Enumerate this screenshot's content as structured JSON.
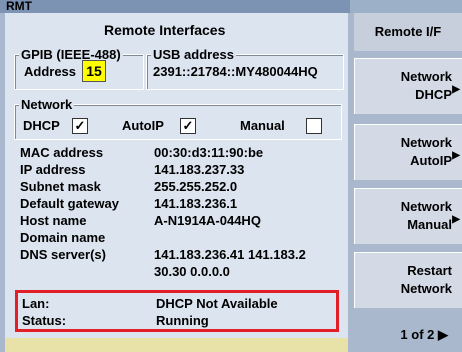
{
  "window": {
    "title": "RMT"
  },
  "panel": {
    "title": "Remote Interfaces"
  },
  "gpib": {
    "legend": "GPIB (IEEE-488)",
    "address_label": "Address",
    "address_value": "15"
  },
  "usb": {
    "legend": "USB address",
    "value": "2391::21784::MY480044HQ"
  },
  "network": {
    "legend": "Network",
    "dhcp_label": "DHCP",
    "dhcp_checked": "✓",
    "autoip_label": "AutoIP",
    "autoip_checked": "✓",
    "manual_label": "Manual",
    "manual_checked": "",
    "rows": [
      {
        "key": "MAC address",
        "value": "00:30:d3:11:90:be"
      },
      {
        "key": "IP address",
        "value": "141.183.237.33"
      },
      {
        "key": "Subnet mask",
        "value": "255.255.252.0"
      },
      {
        "key": "Default gateway",
        "value": "141.183.236.1"
      },
      {
        "key": "Host name",
        "value": "A-N1914A-044HQ"
      },
      {
        "key": "Domain name",
        "value": ""
      },
      {
        "key": "DNS server(s)",
        "value": "141.183.236.41  141.183.2"
      },
      {
        "key": "",
        "value": "30.30  0.0.0.0"
      }
    ]
  },
  "status": {
    "lan_label": "Lan:",
    "lan_value": "DHCP Not Available",
    "status_label": "Status:",
    "status_value": "Running"
  },
  "softkeys": {
    "header": "Remote I/F",
    "keys": [
      {
        "line1": "Network",
        "line2": "DHCP"
      },
      {
        "line1": "Network",
        "line2": "AutoIP"
      },
      {
        "line1": "Network",
        "line2": "Manual"
      },
      {
        "line1": "Restart",
        "line2": "Network"
      }
    ],
    "pager": "1 of 2"
  }
}
